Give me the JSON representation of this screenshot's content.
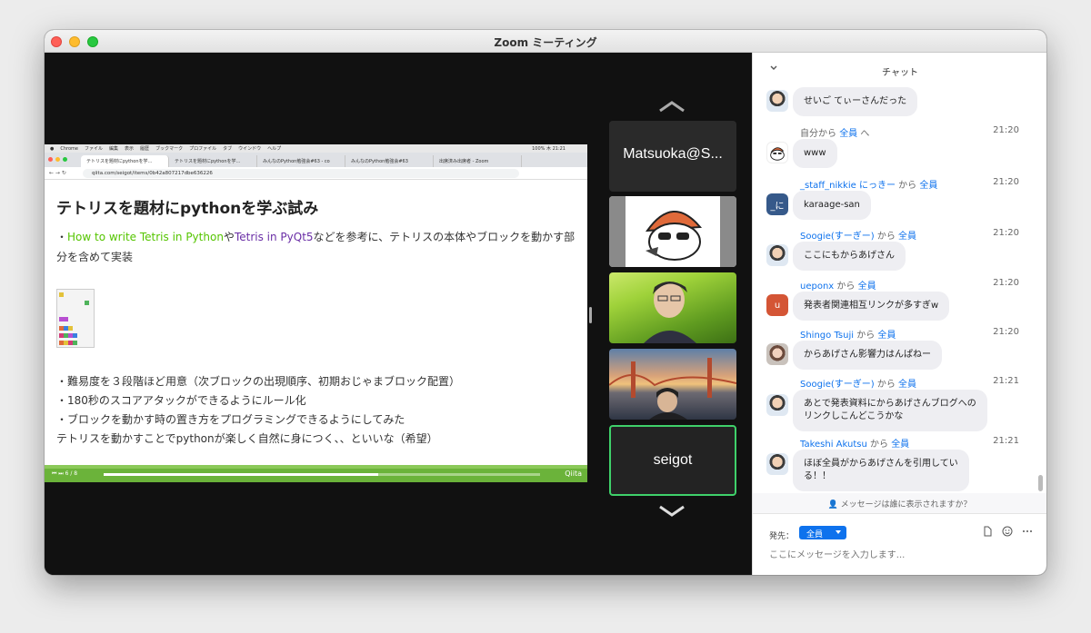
{
  "window": {
    "title": "Zoom ミーティング"
  },
  "share": {
    "mac_menu": [
      "Chrome",
      "ファイル",
      "編集",
      "表示",
      "履歴",
      "ブックマーク",
      "プロファイル",
      "タブ",
      "ウインドウ",
      "ヘルプ"
    ],
    "mac_status": "100%   木 21:21",
    "tabs": [
      "テトリスを題材にpythonを学…",
      "テトリスを題材にpythonを学…",
      "みんなのPython勉強会#63 - co",
      "みんなのPython勉強会#63",
      "出席済み出席者 - Zoom"
    ],
    "url": "qiita.com/seigot/items/0b42a807217dbe636226",
    "slide": {
      "title": "テトリスを題材にpythonを学ぶ試み",
      "p1_prefix": "・",
      "p1_link1": "How to write Tetris in Python",
      "p1_mid": "や",
      "p1_link2": "Tetris in PyQt5",
      "p1_suffix": "などを参考に、テトリスの本体やブロックを動かす部分を含めて実装",
      "list": [
        "・難易度を３段階ほど用意（次ブロックの出現順序、初期おじゃまブロック配置）",
        "・180秒のスコアアタックができるようにルール化",
        "・ブロックを動かす時の置き方をプログラミングできるようにしてみた",
        "テトリスを動かすことでpythonが楽しく自然に身につく、、といいな（希望）"
      ]
    },
    "player": {
      "page": "6 / 8",
      "progress_pct": 63,
      "logo": "Qiita"
    }
  },
  "participants": [
    {
      "name": "Matsuoka@S...",
      "video": false
    },
    {
      "name": "",
      "video": true,
      "kind": "mascot"
    },
    {
      "name": "",
      "video": true,
      "kind": "grass"
    },
    {
      "name": "",
      "video": true,
      "kind": "bridge"
    },
    {
      "name": "seigot",
      "video": false,
      "speaking": true
    }
  ],
  "chat": {
    "title": "チャット",
    "messages": [
      {
        "meta": "",
        "time": "",
        "text": "せいご てぃーさんだった"
      },
      {
        "sender": "自分",
        "from_word": "から",
        "to": "全員",
        "to_suffix": "へ",
        "time": "21:20",
        "text": "www"
      },
      {
        "sender": "_staff_nikkie にっきー",
        "from_word": "から",
        "to": "全員",
        "time": "21:20",
        "text": "karaage-san",
        "avatar_text": "_に"
      },
      {
        "sender": "Soogie(すーぎー)",
        "from_word": "から",
        "to": "全員",
        "time": "21:20",
        "text": "ここにもからあげさん"
      },
      {
        "sender": "ueponx",
        "from_word": "から",
        "to": "全員",
        "time": "21:20",
        "text": "発表者関連相互リンクが多すぎw",
        "avatar_text": "u"
      },
      {
        "sender": "Shingo Tsuji",
        "from_word": "から",
        "to": "全員",
        "time": "21:20",
        "text": "からあげさん影響力はんぱねー"
      },
      {
        "sender": "Soogie(すーぎー)",
        "from_word": "から",
        "to": "全員",
        "time": "21:21",
        "text": "あとで発表資料にからあげさんブログへの",
        "text2": "リンクしこんどこうかな"
      },
      {
        "sender": "Takeshi Akutsu",
        "from_word": "から",
        "to": "全員",
        "time": "21:21",
        "text": "ほぼ全員がからあげさんを引用してい",
        "text2": "る！！"
      }
    ],
    "visibility_notice": "メッセージは誰に表示されますか？",
    "to_label": "発先：",
    "to_value": "全員",
    "input_placeholder": "ここにメッセージを入力します..."
  }
}
